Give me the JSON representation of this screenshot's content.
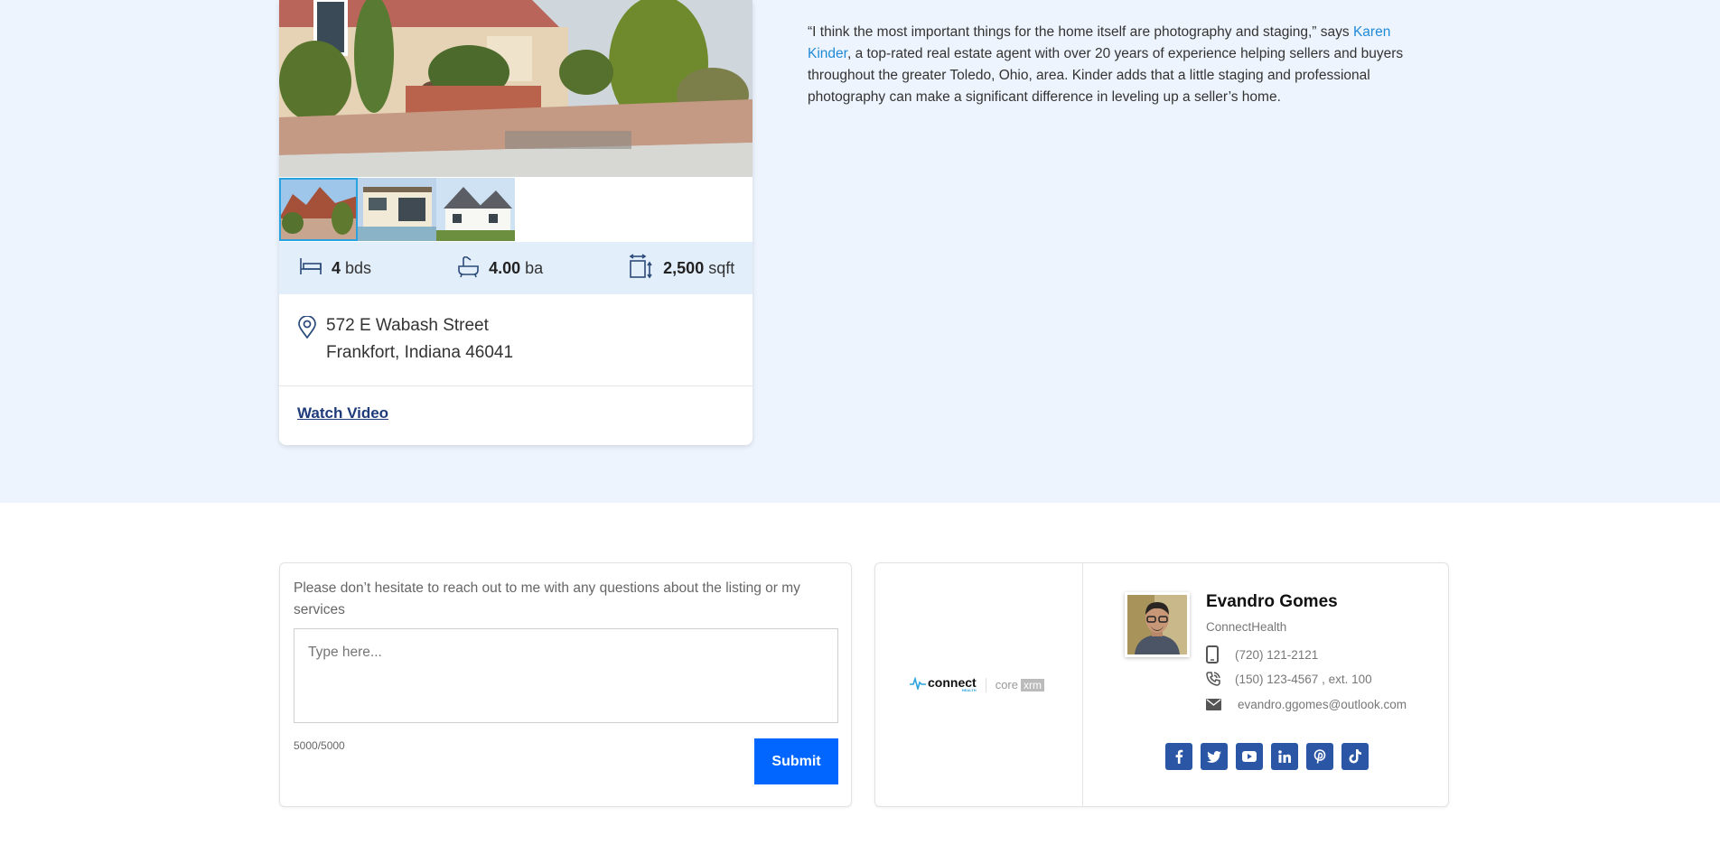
{
  "listing": {
    "specs": {
      "beds_value": "4",
      "beds_unit": "bds",
      "baths_value": "4.00",
      "baths_unit": "ba",
      "area_value": "2,500",
      "area_unit": "sqft"
    },
    "address_line1": "572 E Wabash Street",
    "address_line2": "Frankfort, Indiana 46041",
    "watch_video_label": "Watch Video"
  },
  "quote": {
    "before": "“I think the most important things for the home itself are photography and staging,” says ",
    "link": "Karen Kinder",
    "after": ", a top-rated real estate agent with over 20 years of experience helping sellers and buyers throughout the greater Toledo, Ohio, area. Kinder adds that a little staging and professional photography can make a significant difference in leveling up a seller’s home."
  },
  "contact_form": {
    "intro": "Please don’t hesitate to reach out to me with any questions about the listing or my services",
    "placeholder": "Type here...",
    "char_count": "5000/5000",
    "submit_label": "Submit"
  },
  "agent": {
    "logo_connect": "connect",
    "logo_connect_sub": "HEALTH",
    "logo_core": "core",
    "logo_xrm": "xrm",
    "name": "Evandro Gomes",
    "company": "ConnectHealth",
    "mobile": "(720) 121-2121",
    "office": "(150) 123-4567 , ext. 100",
    "email": "evandro.ggomes@outlook.com",
    "social_icons": [
      "facebook-icon",
      "twitter-icon",
      "youtube-icon",
      "linkedin-icon",
      "pinterest-icon",
      "tiktok-icon"
    ]
  },
  "colors": {
    "band": "#eef4fd",
    "spec_bar": "#e3eefb",
    "link": "#1f8ad8",
    "submit": "#0066ff",
    "social": "#2b56a6"
  }
}
